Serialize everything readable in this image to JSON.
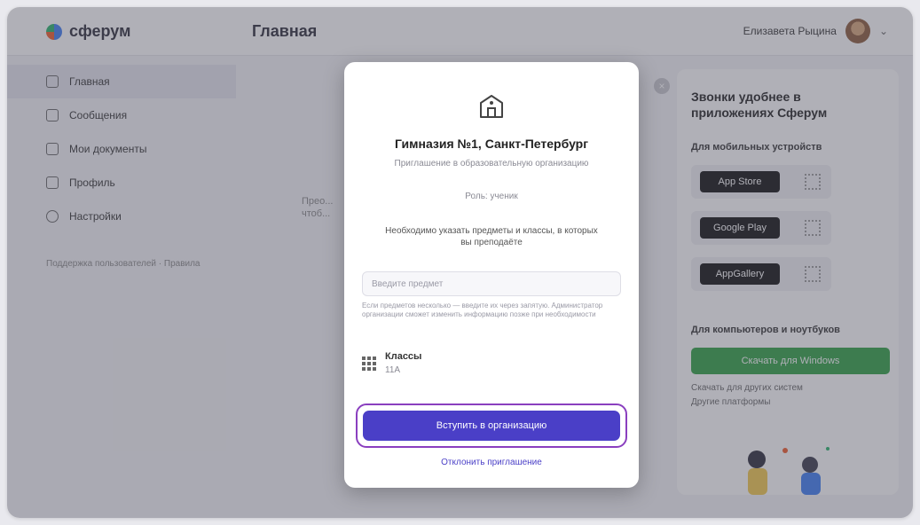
{
  "brand": "сферум",
  "header": {
    "title": "Главная",
    "user_name": "Елизавета Рыцина"
  },
  "sidebar": {
    "items": [
      {
        "label": "Главная",
        "icon": "home-icon"
      },
      {
        "label": "Сообщения",
        "icon": "message-icon"
      },
      {
        "label": "Мои документы",
        "icon": "document-icon"
      },
      {
        "label": "Профиль",
        "icon": "profile-icon"
      },
      {
        "label": "Настройки",
        "icon": "settings-icon"
      }
    ],
    "note": "Поддержка пользователей · Правила"
  },
  "main_text": "Прео... чтоб...",
  "app_panel": {
    "heading": "Звонки удобнее в приложениях Сферум",
    "mobile_label": "Для мобильных устройств",
    "stores": [
      "App Store",
      "Google Play",
      "AppGallery"
    ],
    "desktop_label": "Для компьютеров и ноутбуков",
    "download_button": "Скачать для Windows",
    "link1": "Скачать для других систем",
    "link2": "Другие платформы"
  },
  "modal": {
    "org_name": "Гимназия №1, Санкт-Петербург",
    "description": "Приглашение в образовательную организацию",
    "role": "Роль: ученик",
    "note": "Необходимо указать предметы и классы, в которых вы преподаёте",
    "input_placeholder": "Введите предмет",
    "hint": "Если предметов несколько — введите их через запятую. Администратор организации сможет изменить информацию позже при необходимости",
    "class_label": "Классы",
    "class_value": "11А",
    "join_button": "Вступить в организацию",
    "decline_link": "Отклонить приглашение"
  },
  "colors": {
    "primary": "#4a3fc7",
    "highlight": "#8a3fbf",
    "green": "#2ea043"
  }
}
